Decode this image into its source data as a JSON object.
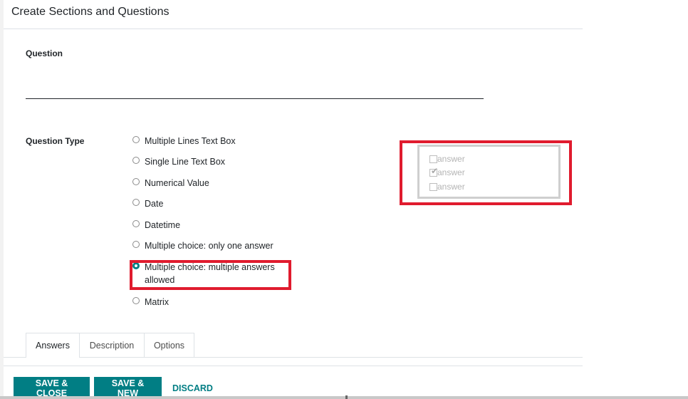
{
  "dialog": {
    "title": "Create Sections and Questions"
  },
  "question": {
    "label": "Question",
    "value": ""
  },
  "question_type": {
    "label": "Question Type",
    "options": [
      {
        "label": "Multiple Lines Text Box",
        "checked": false
      },
      {
        "label": "Single Line Text Box",
        "checked": false
      },
      {
        "label": "Numerical Value",
        "checked": false
      },
      {
        "label": "Date",
        "checked": false
      },
      {
        "label": "Datetime",
        "checked": false
      },
      {
        "label": "Multiple choice: only one answer",
        "checked": false
      },
      {
        "label": "Multiple choice: multiple answers allowed",
        "checked": true
      },
      {
        "label": "Matrix",
        "checked": false
      }
    ]
  },
  "preview": {
    "items": [
      "answer",
      "answer",
      "answer"
    ],
    "checked_index": 1
  },
  "tabs": [
    "Answers",
    "Description",
    "Options"
  ],
  "footer": {
    "save_close": "SAVE & CLOSE",
    "save_new": "SAVE & NEW",
    "discard": "DISCARD"
  },
  "colors": {
    "primary": "#017e84",
    "highlight": "#e01b2e"
  }
}
